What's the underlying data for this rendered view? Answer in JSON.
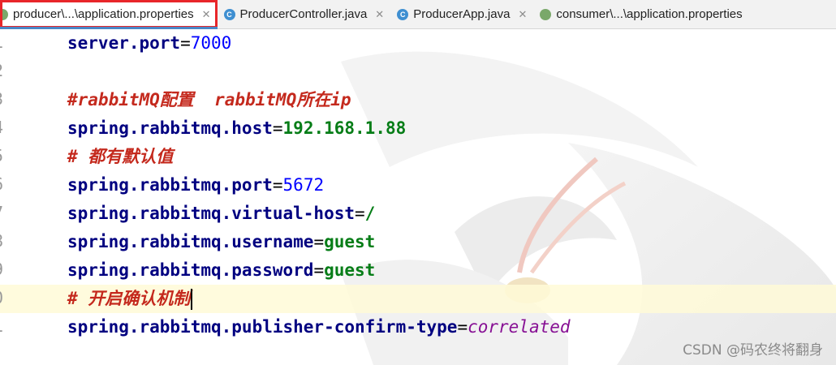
{
  "tabs": [
    {
      "label": "producer\\...\\application.properties",
      "icon": "properties-file-icon",
      "active": true,
      "highlighted": true
    },
    {
      "label": "ProducerController.java",
      "icon": "java-class-icon"
    },
    {
      "label": "ProducerApp.java",
      "icon": "java-class-icon"
    },
    {
      "label": "consumer\\...\\application.properties",
      "icon": "properties-file-icon"
    }
  ],
  "lines": [
    {
      "no": "1",
      "key": "server.port",
      "sep": "=",
      "value": "7000",
      "type": "number"
    },
    {
      "no": "2"
    },
    {
      "no": "3",
      "comment": "#rabbitMQ配置  rabbitMQ所在ip"
    },
    {
      "no": "4",
      "key": "spring.rabbitmq.host",
      "sep": "=",
      "value": "192.168.1.88",
      "type": "string"
    },
    {
      "no": "5",
      "comment": "# 都有默认值"
    },
    {
      "no": "6",
      "key": "spring.rabbitmq.port",
      "sep": "=",
      "value": "5672",
      "type": "number"
    },
    {
      "no": "7",
      "key": "spring.rabbitmq.virtual-host",
      "sep": "=",
      "value": "/",
      "type": "string"
    },
    {
      "no": "8",
      "key": "spring.rabbitmq.username",
      "sep": "=",
      "value": "guest",
      "type": "string"
    },
    {
      "no": "9",
      "key": "spring.rabbitmq.password",
      "sep": "=",
      "value": "guest",
      "type": "string"
    },
    {
      "no": "0",
      "comment": "# 开启确认机制",
      "current": true
    },
    {
      "no": "1",
      "key": "spring.rabbitmq.publisher-confirm-type",
      "sep": "=",
      "value": "correlated",
      "type": "enum"
    }
  ],
  "watermark": "CSDN @码农终将翻身",
  "colors": {
    "highlight_box": "#e8262a",
    "keyword": "#000080",
    "number": "#0000ff",
    "string": "#067d17",
    "comment": "#c4291d",
    "enum": "#871094"
  }
}
